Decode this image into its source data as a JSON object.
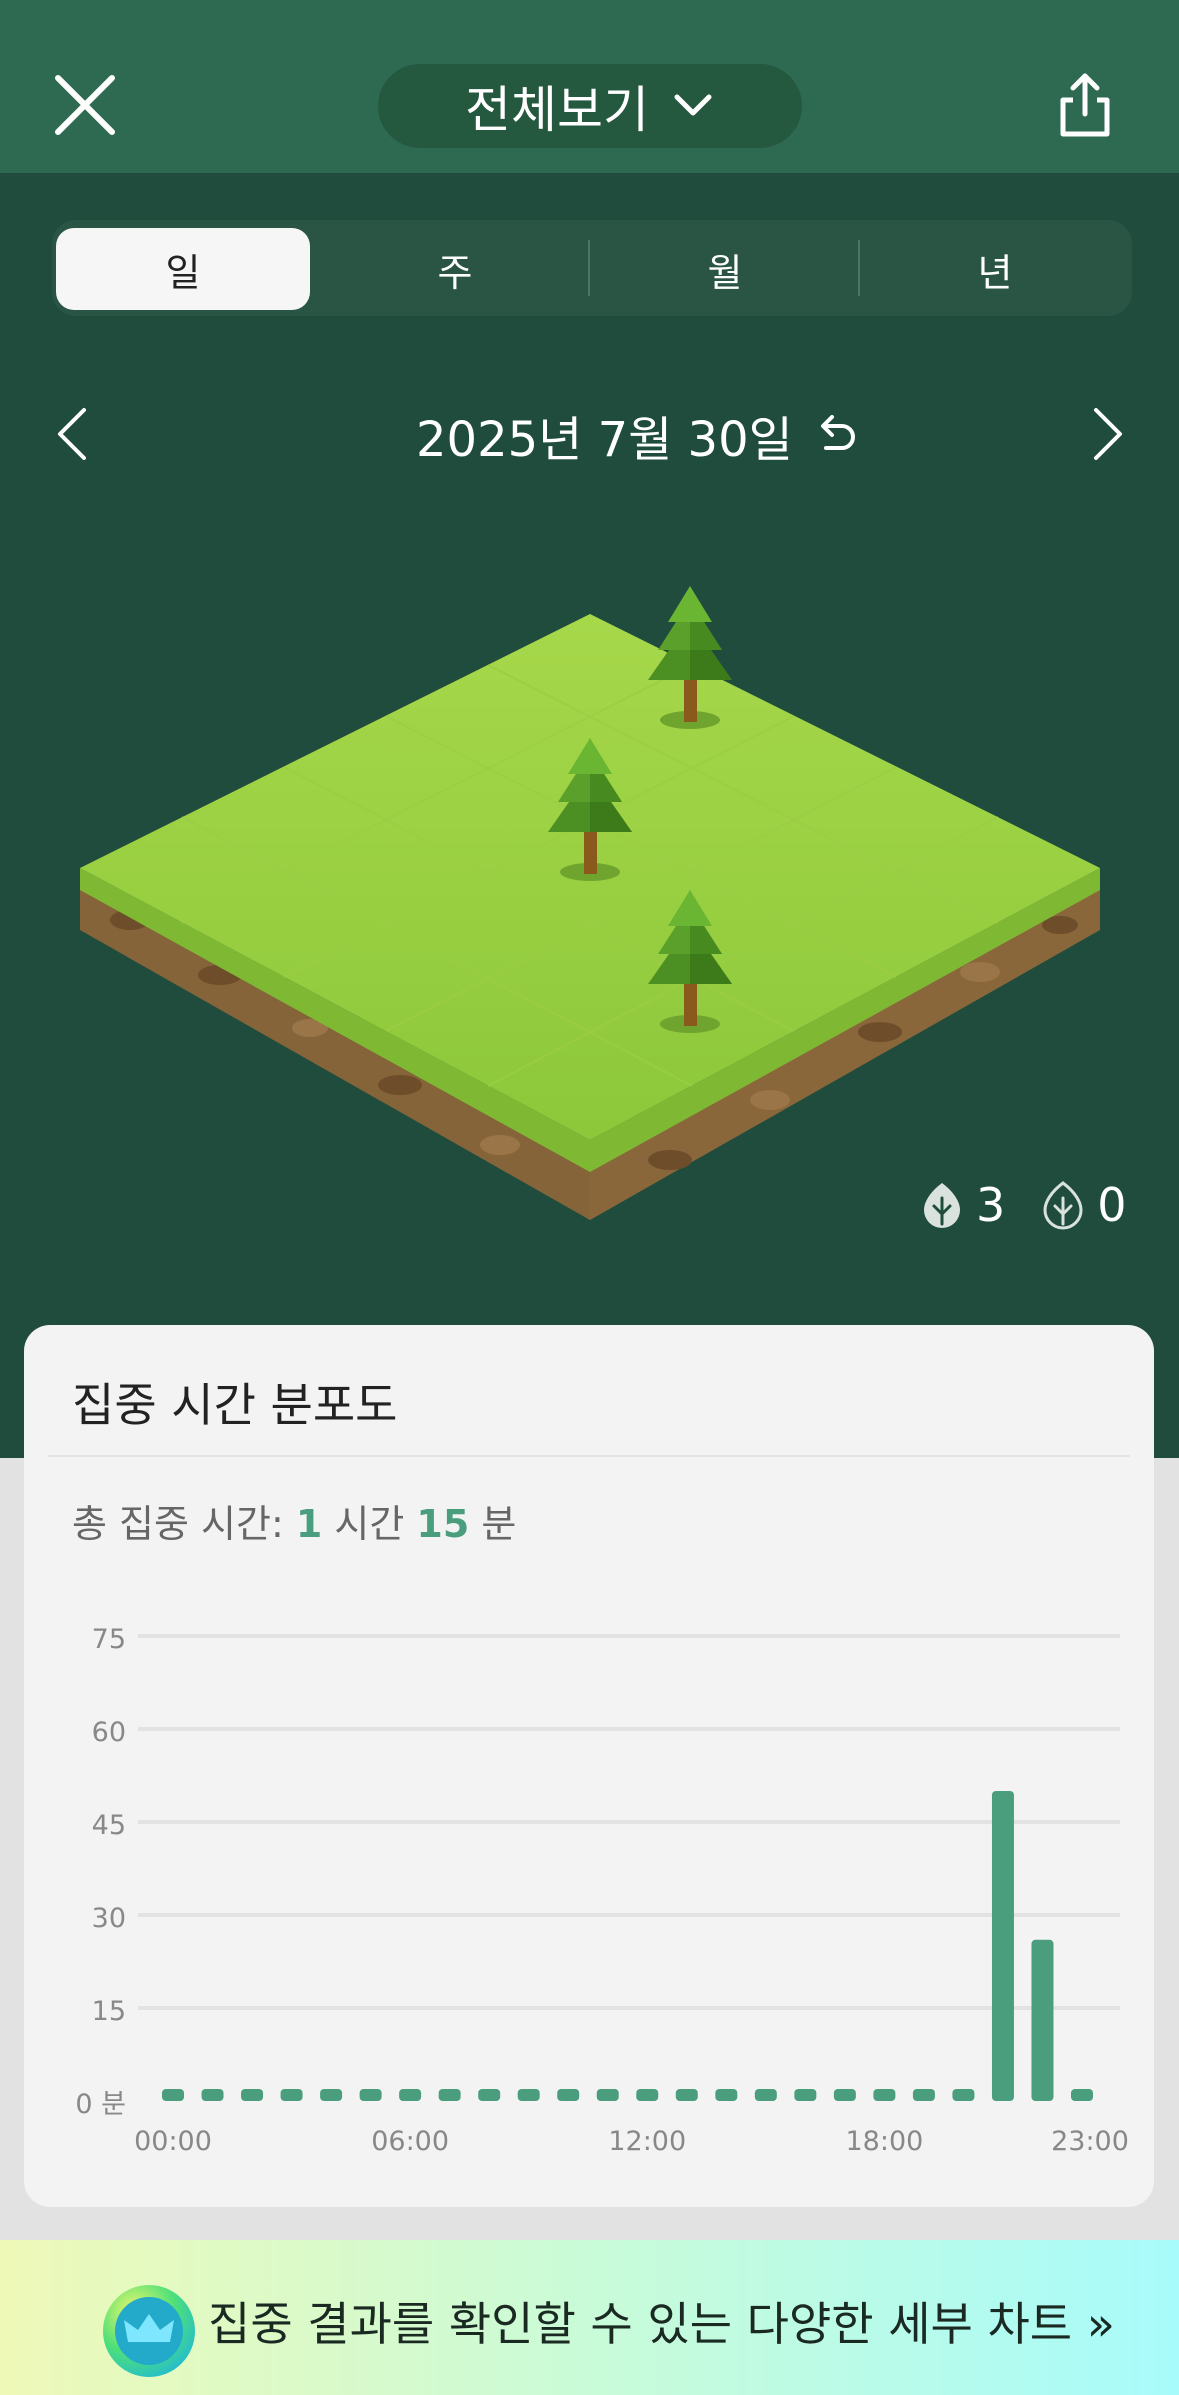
{
  "header": {
    "close_icon": "close-icon",
    "scope_label": "전체보기",
    "share_icon": "share-icon"
  },
  "period_tabs": [
    {
      "label": "일",
      "selected": true
    },
    {
      "label": "주",
      "selected": false
    },
    {
      "label": "월",
      "selected": false
    },
    {
      "label": "년",
      "selected": false
    }
  ],
  "date_nav": {
    "date": "2025년 7월 30일",
    "prev_icon": "chevron-left-icon",
    "next_icon": "chevron-right-icon",
    "reset_icon": "undo-icon"
  },
  "forest": {
    "healthy_count": "3",
    "withered_count": "0"
  },
  "distribution_card": {
    "title": "집중 시간 분포도",
    "total_prefix": "총 집중 시간: ",
    "total_hours": "1",
    "hours_unit": " 시간 ",
    "total_minutes": "15",
    "minutes_unit": " 분"
  },
  "chart_data": {
    "type": "bar",
    "y_unit_label": "분",
    "ylim": [
      0,
      75
    ],
    "y_ticks": [
      0,
      15,
      30,
      45,
      60,
      75
    ],
    "x_tick_labels": [
      "00:00",
      "06:00",
      "12:00",
      "18:00",
      "23:00"
    ],
    "categories": [
      "00",
      "01",
      "02",
      "03",
      "04",
      "05",
      "06",
      "07",
      "08",
      "09",
      "10",
      "11",
      "12",
      "13",
      "14",
      "15",
      "16",
      "17",
      "18",
      "19",
      "20",
      "21",
      "22",
      "23"
    ],
    "values": [
      0,
      0,
      0,
      0,
      0,
      0,
      0,
      0,
      0,
      0,
      0,
      0,
      0,
      0,
      0,
      0,
      0,
      0,
      0,
      0,
      0,
      50,
      26,
      0
    ],
    "color": "#4a9e7e",
    "grid": true
  },
  "promo": {
    "text": "집중 결과를 확인할 수 있는 다양한 세부 차트 »",
    "badge_icon": "crown-icon"
  }
}
